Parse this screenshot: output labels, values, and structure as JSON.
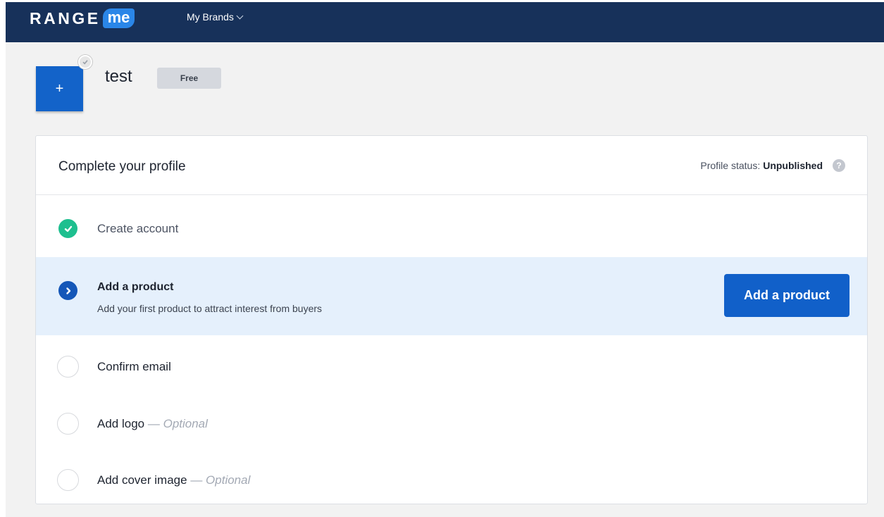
{
  "header": {
    "logo_text": "RANGE",
    "logo_badge": "me",
    "nav_menu": "My Brands"
  },
  "brand": {
    "tile_symbol": "+",
    "name": "test",
    "plan": "Free"
  },
  "profile_card": {
    "title": "Complete your profile",
    "status_label": "Profile status:",
    "status_value": "Unpublished",
    "help_symbol": "?",
    "steps": [
      {
        "label": "Create account",
        "state": "done"
      },
      {
        "label": "Add a product",
        "state": "active",
        "description": "Add your first product to attract interest from buyers",
        "action": "Add a product"
      },
      {
        "label": "Confirm email",
        "state": "todo"
      },
      {
        "label": "Add logo",
        "state": "todo",
        "optional": "Optional"
      },
      {
        "label": "Add cover image",
        "state": "todo",
        "optional": "Optional"
      }
    ],
    "dash": "—"
  },
  "colors": {
    "nav_bg": "#17315a",
    "accent": "#1160c9",
    "success": "#1ebf8f",
    "active_row": "#e5f0fc"
  }
}
